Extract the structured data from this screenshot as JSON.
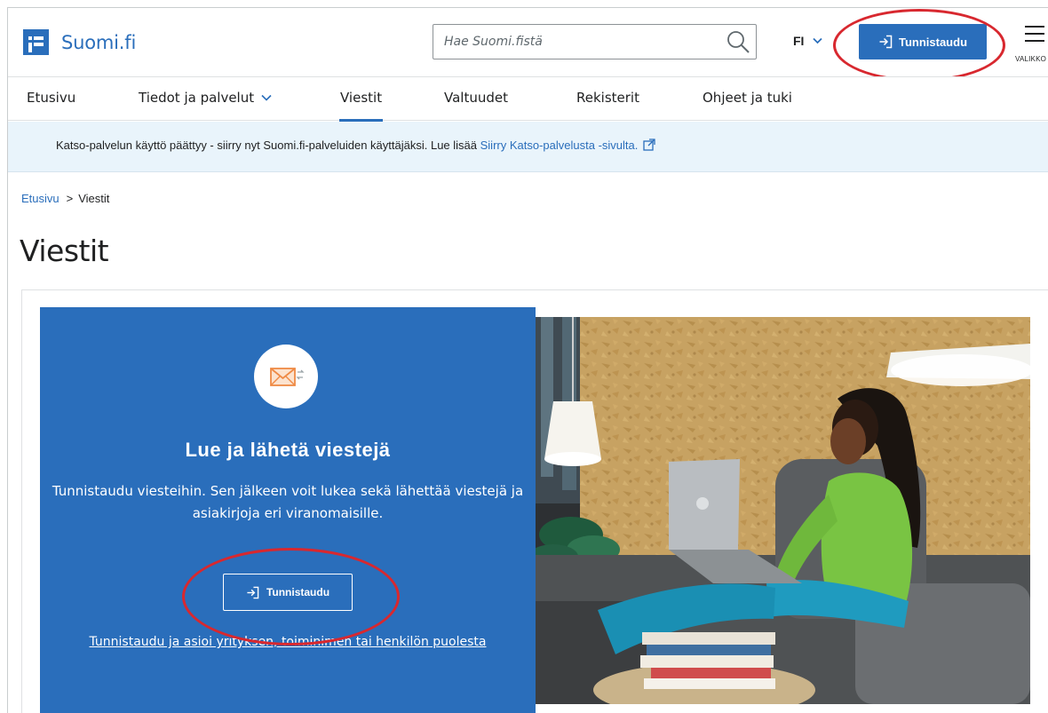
{
  "header": {
    "logo_text": "Suomi.fi",
    "search_placeholder": "Hae Suomi.fistä",
    "language": "FI",
    "login_label": "Tunnistaudu",
    "menu_label": "VALIKKO"
  },
  "nav": {
    "items": [
      {
        "label": "Etusivu"
      },
      {
        "label": "Tiedot ja palvelut"
      },
      {
        "label": "Viestit"
      },
      {
        "label": "Valtuudet"
      },
      {
        "label": "Rekisterit"
      },
      {
        "label": "Ohjeet ja tuki"
      }
    ],
    "active": "Viestit"
  },
  "notice": {
    "text": "Katso-palvelun käyttö päättyy - siirry nyt Suomi.fi-palveluiden käyttäjäksi. Lue lisää ",
    "link": "Siirry Katso-palvelusta -sivulta."
  },
  "breadcrumb": {
    "home": "Etusivu",
    "separator": ">",
    "current": "Viestit"
  },
  "page_title": "Viestit",
  "panel": {
    "title": "Lue ja lähetä viestejä",
    "description": "Tunnistaudu viesteihin. Sen jälkeen voit lukea sekä lähettää viestejä ja asiakirjoja eri viranomaisille.",
    "button_label": "Tunnistaudu",
    "link": "Tunnistaudu ja asioi yrityksen, toiminimen tai henkilön puolesta"
  },
  "colors": {
    "brand_blue": "#2a6ebb",
    "notice_bg": "#e9f4fb",
    "annotation_red": "#d8282f"
  },
  "icons": [
    "logo-icon",
    "search-icon",
    "chevron-down-icon",
    "login-icon",
    "menu-icon",
    "external-link-icon",
    "message-icon"
  ]
}
